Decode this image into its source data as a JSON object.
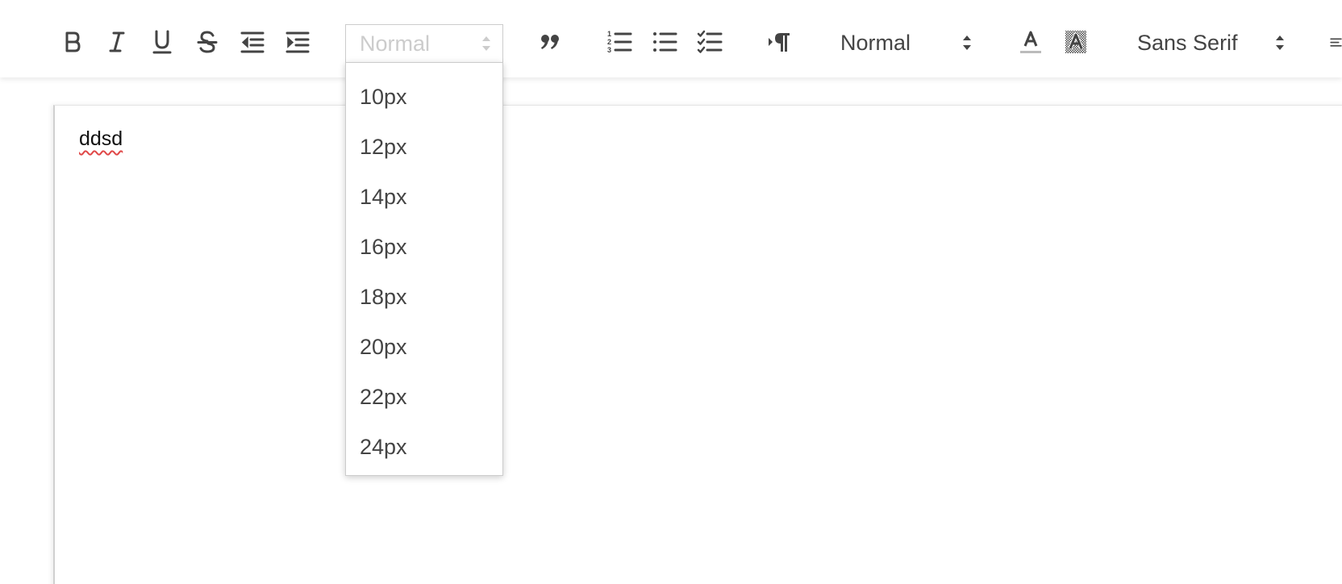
{
  "toolbar": {
    "buttons": [
      {
        "name": "bold",
        "icon": "bold-icon"
      },
      {
        "name": "italic",
        "icon": "italic-icon"
      },
      {
        "name": "underline",
        "icon": "underline-icon"
      },
      {
        "name": "strike",
        "icon": "strikethrough-icon"
      },
      {
        "name": "outdent",
        "icon": "outdent-icon"
      },
      {
        "name": "indent",
        "icon": "indent-icon"
      },
      {
        "name": "blockquote",
        "icon": "blockquote-icon"
      },
      {
        "name": "ordered-list",
        "icon": "ordered-list-icon"
      },
      {
        "name": "bullet-list",
        "icon": "bullet-list-icon"
      },
      {
        "name": "check-list",
        "icon": "check-list-icon"
      },
      {
        "name": "direction",
        "icon": "text-direction-icon"
      },
      {
        "name": "text-color",
        "icon": "text-color-icon"
      },
      {
        "name": "background-color",
        "icon": "background-color-icon"
      }
    ],
    "size_picker": {
      "selected": "Normal",
      "open": true,
      "options": [
        "10px",
        "12px",
        "14px",
        "16px",
        "18px",
        "20px",
        "22px",
        "24px"
      ]
    },
    "header_picker": {
      "selected": "Normal"
    },
    "font_picker": {
      "selected": "Sans Serif"
    }
  },
  "editor": {
    "content": "ddsd"
  },
  "colors": {
    "icon": "#444444",
    "picker_placeholder": "#cccccc",
    "border": "#cccccc",
    "spellcheck": "#e04848"
  }
}
